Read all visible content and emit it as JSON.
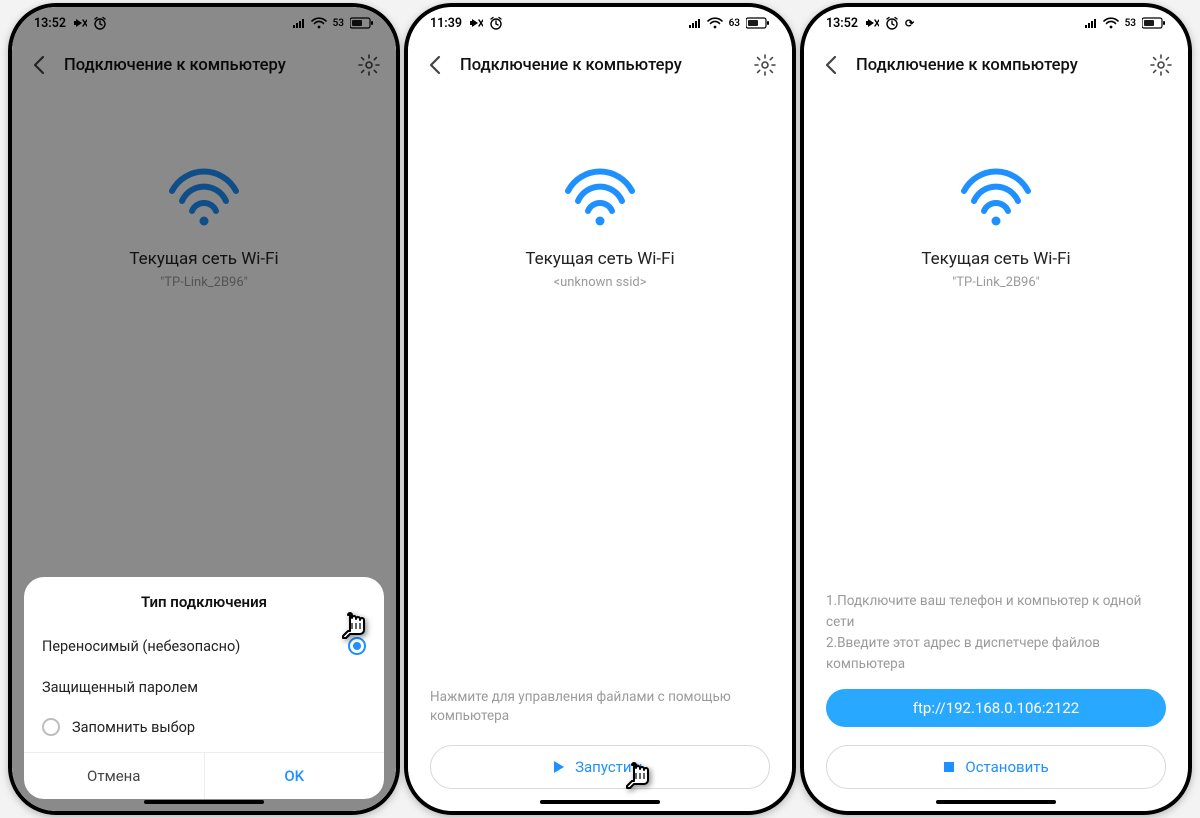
{
  "accent": "#1e90ff",
  "screens": [
    {
      "status": {
        "time": "13:52",
        "battery": "53"
      },
      "title": "Подключение к компьютеру",
      "wifi_label": "Текущая сеть Wi-Fi",
      "wifi_ssid": "\"TP-Link_2B96\"",
      "dialog": {
        "title": "Тип подключения",
        "option_portable": "Переносимый (небезопасно)",
        "option_secure": "Защищенный паролем",
        "remember": "Запомнить выбор",
        "cancel": "Отмена",
        "ok": "OK"
      }
    },
    {
      "status": {
        "time": "11:39",
        "battery": "63"
      },
      "title": "Подключение к компьютеру",
      "wifi_label": "Текущая сеть Wi-Fi",
      "wifi_ssid": "<unknown ssid>",
      "hint": "Нажмите для управления файлами с помощью компьютера",
      "start_label": "Запустить"
    },
    {
      "status": {
        "time": "13:52",
        "battery": "53"
      },
      "title": "Подключение к компьютеру",
      "wifi_label": "Текущая сеть Wi-Fi",
      "wifi_ssid": "\"TP-Link_2B96\"",
      "instructions_1": "1.Подключите ваш телефон и компьютер к одной сети",
      "instructions_2": "2.Введите этот адрес в диспетчере файлов компьютера",
      "ftp_address": "ftp://192.168.0.106:2122",
      "stop_label": "Остановить"
    }
  ]
}
